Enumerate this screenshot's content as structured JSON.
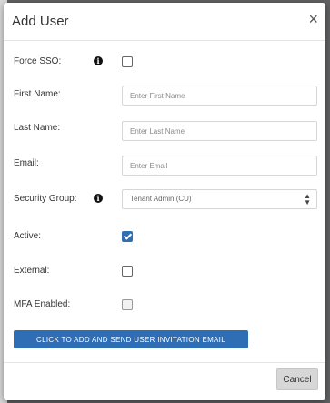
{
  "modal": {
    "title": "Add User",
    "close_glyph": "×"
  },
  "fields": {
    "force_sso": {
      "label": "Force SSO:",
      "checked": false
    },
    "first_name": {
      "label": "First Name:",
      "placeholder": "Enter First Name",
      "value": ""
    },
    "last_name": {
      "label": "Last Name:",
      "placeholder": "Enter Last Name",
      "value": ""
    },
    "email": {
      "label": "Email:",
      "placeholder": "Enter Email",
      "value": ""
    },
    "security_group": {
      "label": "Security Group:",
      "selected": "Tenant Admin (CU)"
    },
    "active": {
      "label": "Active:",
      "checked": true
    },
    "external": {
      "label": "External:",
      "checked": false
    },
    "mfa_enabled": {
      "label": "MFA Enabled:",
      "checked": false,
      "disabled": true
    }
  },
  "icons": {
    "info": "i",
    "caret": "▲▼"
  },
  "buttons": {
    "invite": "CLICK TO ADD AND SEND USER INVITATION EMAIL",
    "cancel": "Cancel"
  },
  "colors": {
    "primary": "#2f6eb5",
    "cancel_bg": "#d7d7d7"
  }
}
